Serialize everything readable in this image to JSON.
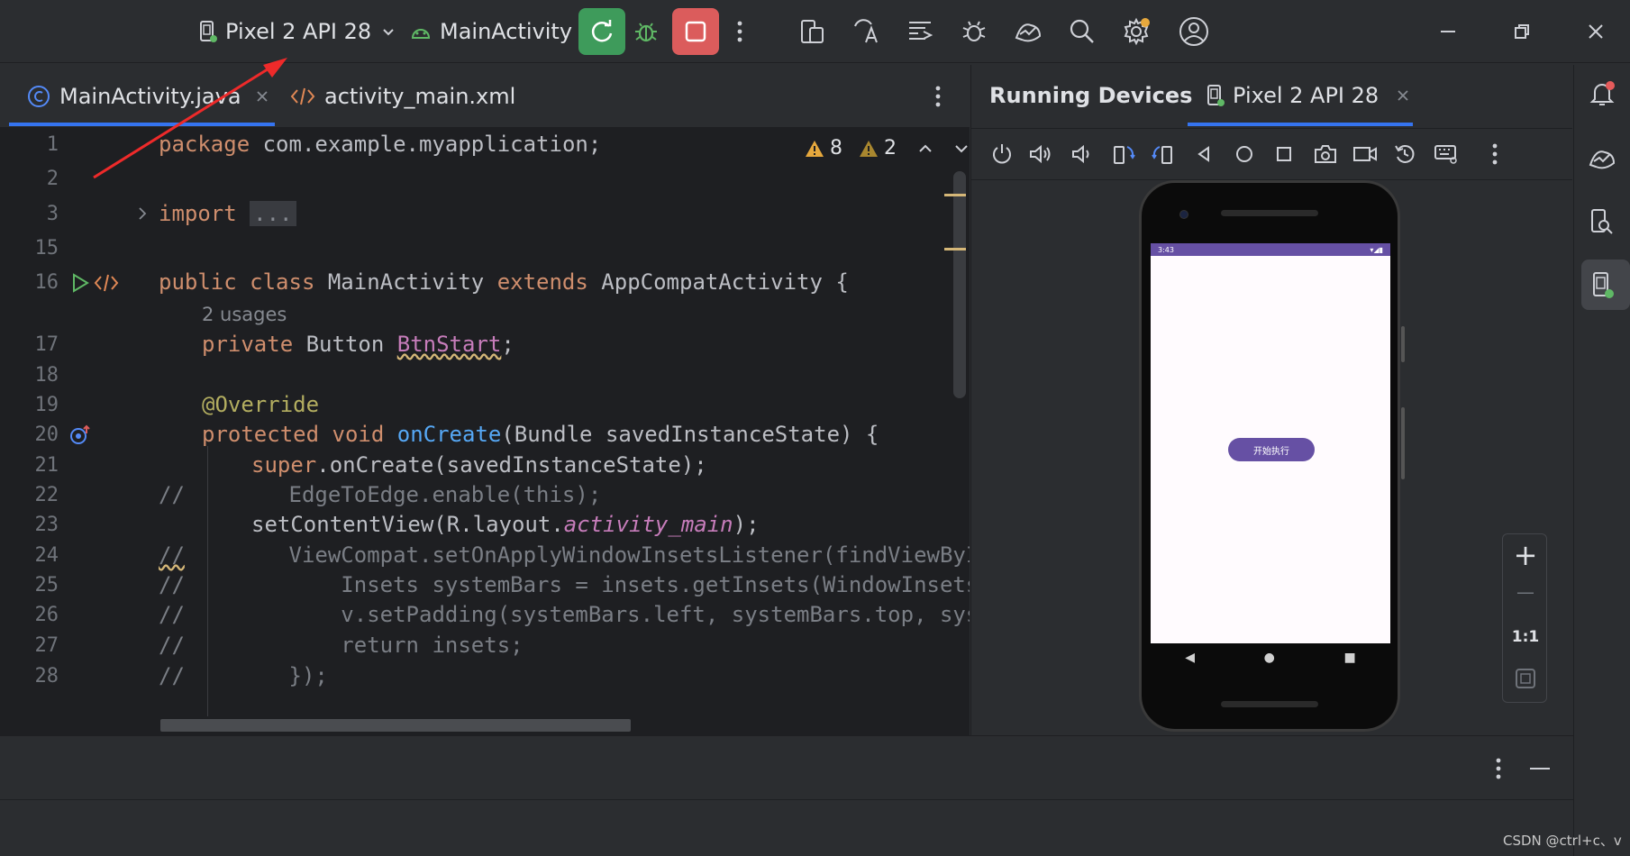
{
  "toolbar": {
    "device_label": "Pixel 2 API 28",
    "run_config_label": "MainActivity",
    "accent": "#3574f0",
    "apply_changes_color": "#3e9b5b",
    "stop_color": "#db5c5c"
  },
  "editor": {
    "tabs": [
      {
        "label": "MainActivity.java",
        "icon": "java-class-icon",
        "active": true
      },
      {
        "label": "activity_main.xml",
        "icon": "xml-icon",
        "active": false
      }
    ],
    "warnings_count": "8",
    "weak_warnings_count": "2",
    "lines": {
      "l1": "1",
      "l2": "2",
      "l3": "3",
      "l15": "15",
      "l16": "16",
      "l17": "17",
      "l18": "18",
      "l19": "19",
      "l20": "20",
      "l21": "21",
      "l22": "22",
      "l23": "23",
      "l24": "24",
      "l25": "25",
      "l26": "26",
      "l27": "27",
      "l28": "28"
    },
    "code": {
      "c1_kw": "package",
      "c1_rest": " com.example.myapplication;",
      "c3_kw": "import",
      "c3_fold": "...",
      "c16_kw1": "public class",
      "c16_name": " MainActivity ",
      "c16_kw2": "extends",
      "c16_rest": " AppCompatActivity {",
      "usages_hint": "2 usages",
      "c17_kw": "private",
      "c17_type": " Button ",
      "c17_field": "BtnStart",
      "c17_end": ";",
      "c19_ann": "@Override",
      "c20_kw": "protected void",
      "c20_fn": " onCreate",
      "c20_rest": "(Bundle savedInstanceState) {",
      "c21_kw": "super",
      "c21_rest": ".onCreate(savedInstanceState);",
      "c22_cm": "//",
      "c22_rest": "        EdgeToEdge.enable(this);",
      "c23_a": "setContentView(R.layout.",
      "c23_it": "activity_main",
      "c23_b": ");",
      "c24_cm": "//",
      "c24_rest": "        ViewCompat.setOnApplyWindowInsetsListener(findViewById",
      "c25_cm": "//",
      "c25_rest": "            Insets systemBars = insets.getInsets(WindowInsetsCo",
      "c26_cm": "//",
      "c26_rest": "            v.setPadding(systemBars.left, systemBars.top, syste",
      "c27_cm": "//",
      "c27_rest": "            return insets;",
      "c28_cm": "//",
      "c28_rest": "        });"
    }
  },
  "running_devices": {
    "title": "Running Devices",
    "tab_label": "Pixel 2 API 28",
    "phone": {
      "status_time": "3:43",
      "button_label": "开始执行",
      "accent": "#6650a4"
    },
    "zoom": {
      "plus": "+",
      "minus": "—",
      "one_to_one": "1:1"
    }
  },
  "footer": {
    "watermark": "CSDN @ctrl+c、v"
  }
}
